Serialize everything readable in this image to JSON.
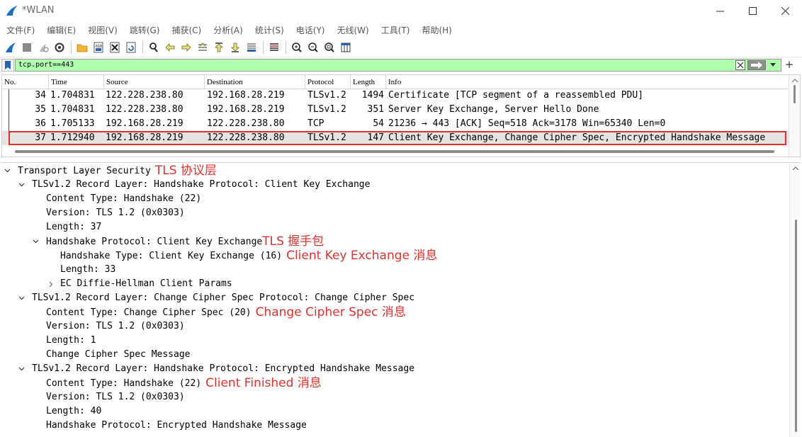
{
  "window": {
    "title": "*WLAN"
  },
  "menu": [
    "文件(F)",
    "编辑(E)",
    "视图(V)",
    "跳转(G)",
    "捕获(C)",
    "分析(A)",
    "统计(S)",
    "电话(Y)",
    "无线(W)",
    "工具(T)",
    "帮助(H)"
  ],
  "toolbar_icons": [
    "shark-fin-start-icon",
    "stop-square-icon",
    "restart-capture-icon",
    "capture-options-gear-icon",
    "open-folder-icon",
    "save-file-icon",
    "close-file-icon",
    "reload-file-icon",
    "find-magnifier-icon",
    "go-back-arrow-icon",
    "go-forward-arrow-icon",
    "go-to-packet-icon",
    "go-first-icon",
    "go-last-icon",
    "auto-scroll-icon",
    "colorize-lines-icon",
    "zoom-in-icon",
    "zoom-out-icon",
    "zoom-normal-icon",
    "resize-columns-icon"
  ],
  "filter": {
    "value": "tcp.port==443",
    "bg_color": "#afffaf"
  },
  "packet_list": {
    "columns": [
      "No.",
      "Time",
      "Source",
      "Destination",
      "Protocol",
      "Length",
      "Info"
    ],
    "rows": [
      {
        "no": "34",
        "time": "1.704831",
        "source": "122.228.238.80",
        "destination": "192.168.28.219",
        "protocol": "TLSv1.2",
        "length": "1494",
        "info": "Certificate [TCP segment of a reassembled PDU]"
      },
      {
        "no": "35",
        "time": "1.704831",
        "source": "122.228.238.80",
        "destination": "192.168.28.219",
        "protocol": "TLSv1.2",
        "length": "351",
        "info": "Server Key Exchange, Server Hello Done"
      },
      {
        "no": "36",
        "time": "1.705133",
        "source": "192.168.28.219",
        "destination": "122.228.238.80",
        "protocol": "TCP",
        "length": "54",
        "info": "21236 → 443 [ACK] Seq=518 Ack=3178 Win=65340 Len=0"
      },
      {
        "no": "37",
        "time": "1.712940",
        "source": "192.168.28.219",
        "destination": "122.228.238.80",
        "protocol": "TLSv1.2",
        "length": "147",
        "info": "Client Key Exchange, Change Cipher Spec, Encrypted Handshake Message"
      }
    ],
    "selected_index": 3,
    "highlight_color": "#e0302c"
  },
  "details": {
    "lines": [
      {
        "text": "Transport Layer Security",
        "state": "expanded",
        "annotation": "TLS 协议层"
      },
      {
        "text": "TLSv1.2 Record Layer: Handshake Protocol: Client Key Exchange",
        "state": "expanded",
        "annotation": ""
      },
      {
        "text": "Content Type: Handshake (22)",
        "state": "leaf",
        "annotation": ""
      },
      {
        "text": "Version: TLS 1.2 (0x0303)",
        "state": "leaf",
        "annotation": ""
      },
      {
        "text": "Length: 37",
        "state": "leaf",
        "annotation": ""
      },
      {
        "text": "Handshake Protocol: Client Key Exchange",
        "state": "expanded",
        "annotation": "TLS 握手包"
      },
      {
        "text": "Handshake Type: Client Key Exchange (16)",
        "state": "leaf",
        "annotation": "Client Key Exchange 消息"
      },
      {
        "text": "Length: 33",
        "state": "leaf",
        "annotation": ""
      },
      {
        "text": "EC Diffie-Hellman Client Params",
        "state": "collapsed",
        "annotation": ""
      },
      {
        "text": "TLSv1.2 Record Layer: Change Cipher Spec Protocol: Change Cipher Spec",
        "state": "expanded",
        "annotation": ""
      },
      {
        "text": "Content Type: Change Cipher Spec (20)",
        "state": "leaf",
        "annotation": "Change Cipher Spec 消息"
      },
      {
        "text": "Version: TLS 1.2 (0x0303)",
        "state": "leaf",
        "annotation": ""
      },
      {
        "text": "Length: 1",
        "state": "leaf",
        "annotation": ""
      },
      {
        "text": "Change Cipher Spec Message",
        "state": "leaf",
        "annotation": ""
      },
      {
        "text": "TLSv1.2 Record Layer: Handshake Protocol: Encrypted Handshake Message",
        "state": "expanded",
        "annotation": ""
      },
      {
        "text": "Content Type: Handshake (22)",
        "state": "leaf",
        "annotation": "Client Finished 消息"
      },
      {
        "text": "Version: TLS 1.2 (0x0303)",
        "state": "leaf",
        "annotation": ""
      },
      {
        "text": "Length: 40",
        "state": "leaf",
        "annotation": ""
      },
      {
        "text": "Handshake Protocol: Encrypted Handshake Message",
        "state": "leaf",
        "annotation": ""
      }
    ],
    "annotation_color": "#e0302c"
  }
}
